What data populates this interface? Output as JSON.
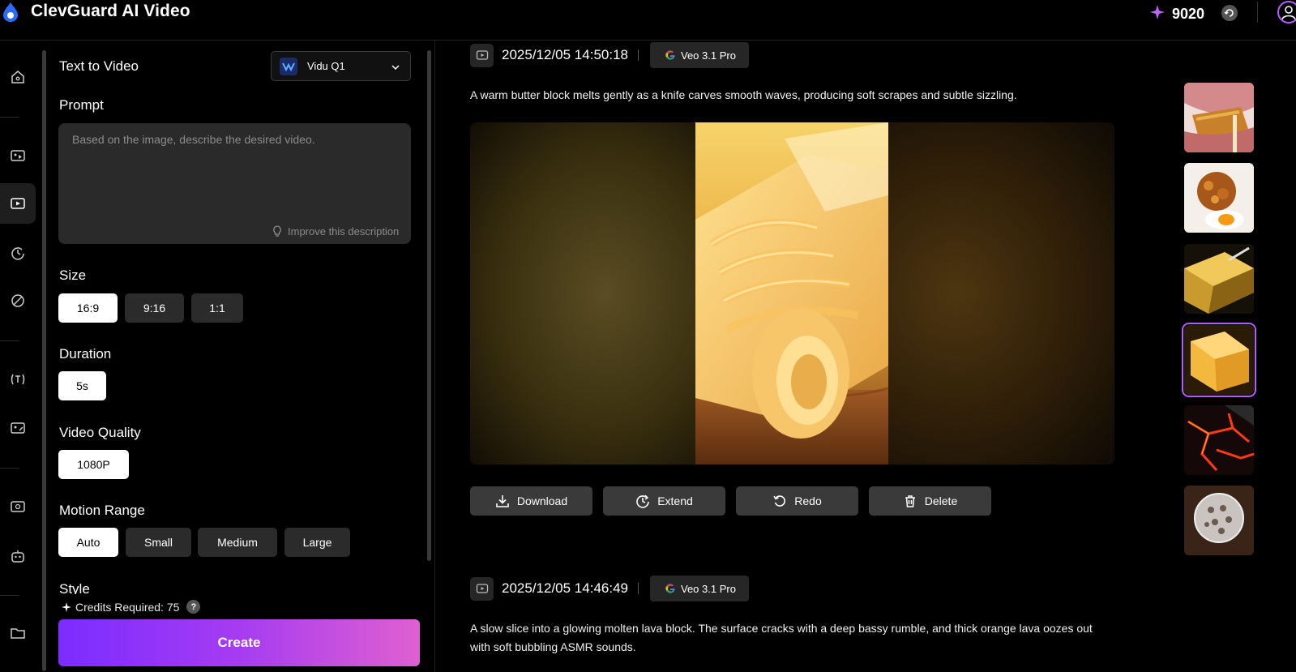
{
  "app": {
    "title": "ClevGuard AI Video",
    "credits": "9020"
  },
  "panel": {
    "mode_title": "Text to Video",
    "model": "Vidu Q1",
    "prompt_label": "Prompt",
    "prompt_placeholder": "Based on the image, describe the desired video.",
    "improve_label": "Improve this description",
    "size_label": "Size",
    "sizes": [
      "16:9",
      "9:16",
      "1:1"
    ],
    "duration_label": "Duration",
    "durations": [
      "5s"
    ],
    "quality_label": "Video Quality",
    "qualities": [
      "1080P"
    ],
    "motion_label": "Motion Range",
    "motions": [
      "Auto",
      "Small",
      "Medium",
      "Large"
    ],
    "style_label": "Style",
    "credits_required": "Credits Required: 75",
    "create_label": "Create"
  },
  "feed": [
    {
      "time": "2025/12/05 14:50:18",
      "model": "Veo 3.1 Pro",
      "description": "A warm butter block melts gently as a knife carves smooth waves, producing soft scrapes and subtle sizzling."
    },
    {
      "time": "2025/12/05 14:46:49",
      "model": "Veo 3.1 Pro",
      "description": "A slow slice into a glowing molten lava block. The surface cracks with a deep bassy rumble, and thick orange lava oozes out with soft bubbling ASMR sounds."
    }
  ],
  "actions": {
    "download": "Download",
    "extend": "Extend",
    "redo": "Redo",
    "delete": "Delete"
  },
  "thumbnails": {
    "items": [
      "crispy-food-bite",
      "fried-chicken-egg",
      "gold-bar",
      "butter-block",
      "molten-lava",
      "crystal-sphere"
    ],
    "selected": 3
  },
  "colors": {
    "accent": "#b35cff",
    "create_start": "#7b2cff",
    "create_end": "#e060d0",
    "chip_bg": "#2b2b2b"
  }
}
